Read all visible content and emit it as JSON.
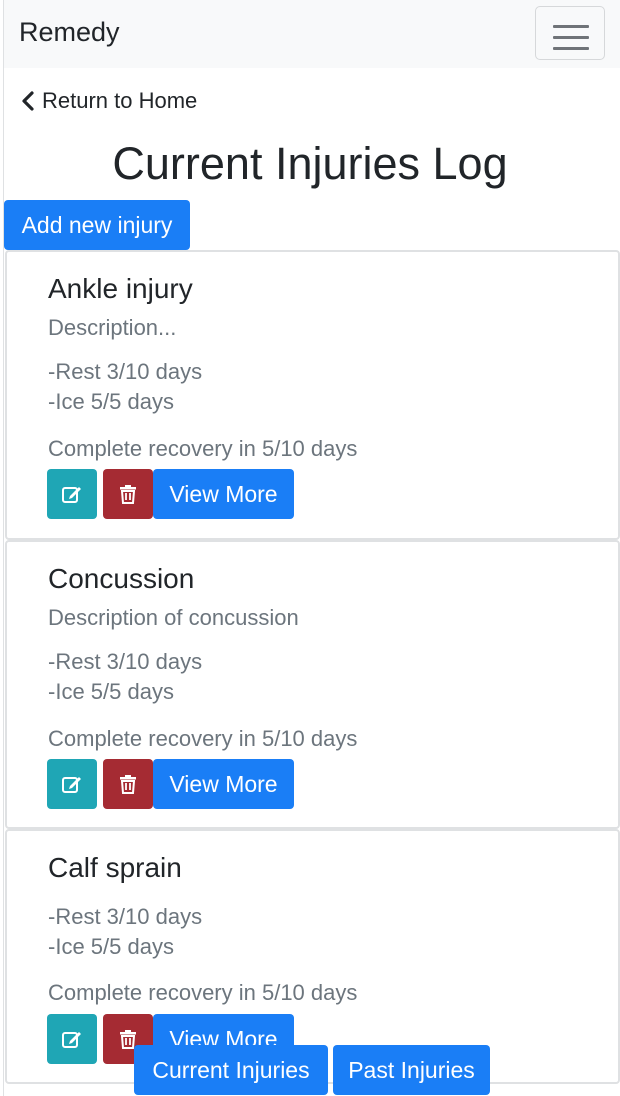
{
  "app": {
    "brand": "Remedy",
    "menu_icon": "hamburger-icon"
  },
  "nav": {
    "back_label": "Return to Home",
    "back_icon": "chevron-left-icon"
  },
  "page": {
    "title": "Current Injuries Log",
    "add_button_label": "Add new injury"
  },
  "injuries": [
    {
      "title": "Ankle injury",
      "description": "Description...",
      "treatments": [
        "-Rest 3/10 days",
        "-Ice 5/5 days"
      ],
      "recovery": "Complete recovery in 5/10 days",
      "view_more_label": "View More"
    },
    {
      "title": "Concussion",
      "description": "Description of concussion",
      "treatments": [
        "-Rest 3/10 days",
        "-Ice 5/5 days"
      ],
      "recovery": "Complete recovery in 5/10 days",
      "view_more_label": "View More"
    },
    {
      "title": "Calf sprain",
      "treatments": [
        "-Rest 3/10 days",
        "-Ice 5/5 days"
      ],
      "recovery": "Complete recovery in 5/10 days",
      "view_more_label": "View More"
    }
  ],
  "card_icons": {
    "edit": "edit-icon",
    "delete": "trash-icon"
  },
  "bottom_tabs": {
    "current_label": "Current Injuries",
    "past_label": "Past Injuries"
  },
  "colors": {
    "primary": "#1a7ef6",
    "info": "#1fa6b5",
    "danger": "#a52b33",
    "muted_text": "#6c757d",
    "navbar_bg": "#f8f9fa"
  }
}
